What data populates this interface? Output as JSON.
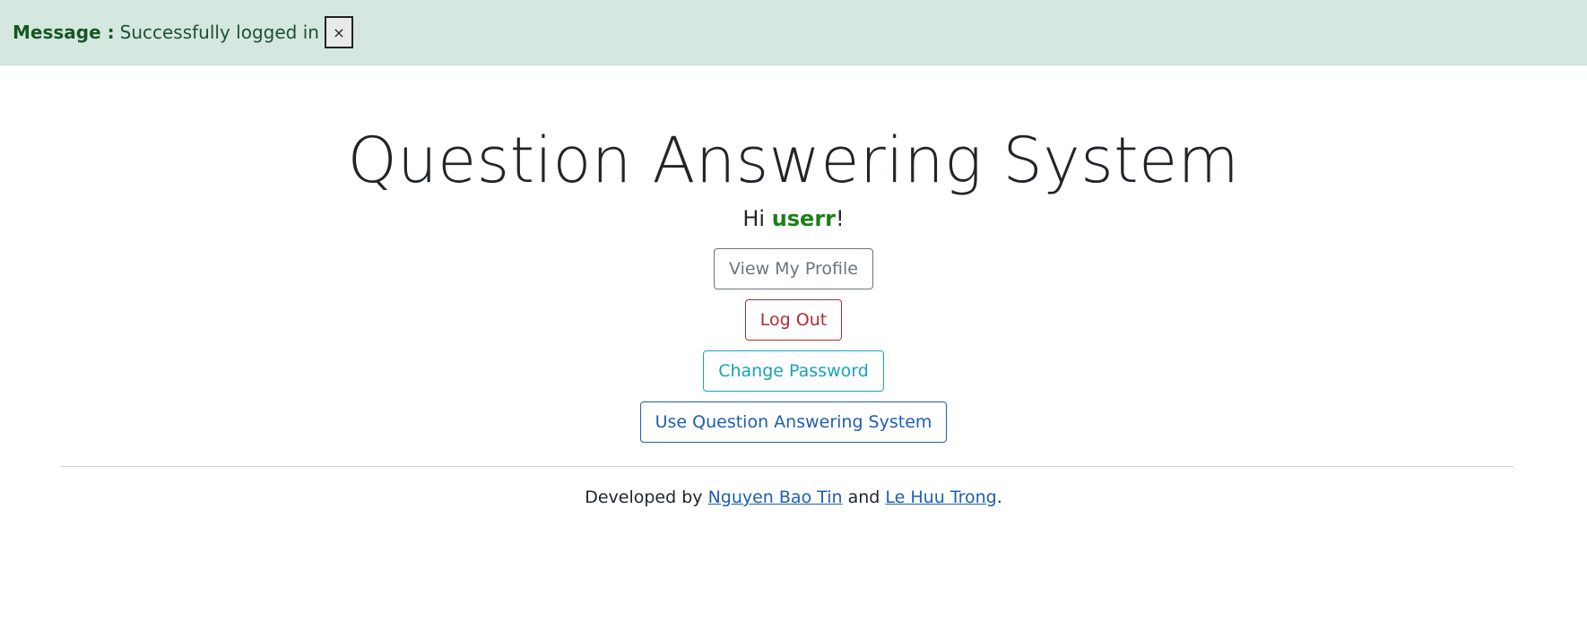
{
  "alert": {
    "label": "Message :",
    "text": "Successfully logged in",
    "close_symbol": "×"
  },
  "main": {
    "title": "Question Answering System",
    "greeting_prefix": "Hi ",
    "username": "userr",
    "greeting_suffix": "!",
    "buttons": {
      "profile": "View My Profile",
      "logout": "Log Out",
      "change_password": "Change Password",
      "use_system": "Use Question Answering System"
    }
  },
  "footer": {
    "prefix": "Developed by ",
    "author1": "Nguyen Bao Tin",
    "conjunction": " and ",
    "author2": "Le Huu Trong",
    "suffix": "."
  },
  "colors": {
    "alert_bg": "#d4e8df",
    "username": "#1a7f1a",
    "secondary": "#6c757d",
    "danger": "#b02a37",
    "info": "#17a2b8",
    "primary": "#1c5fb0"
  }
}
